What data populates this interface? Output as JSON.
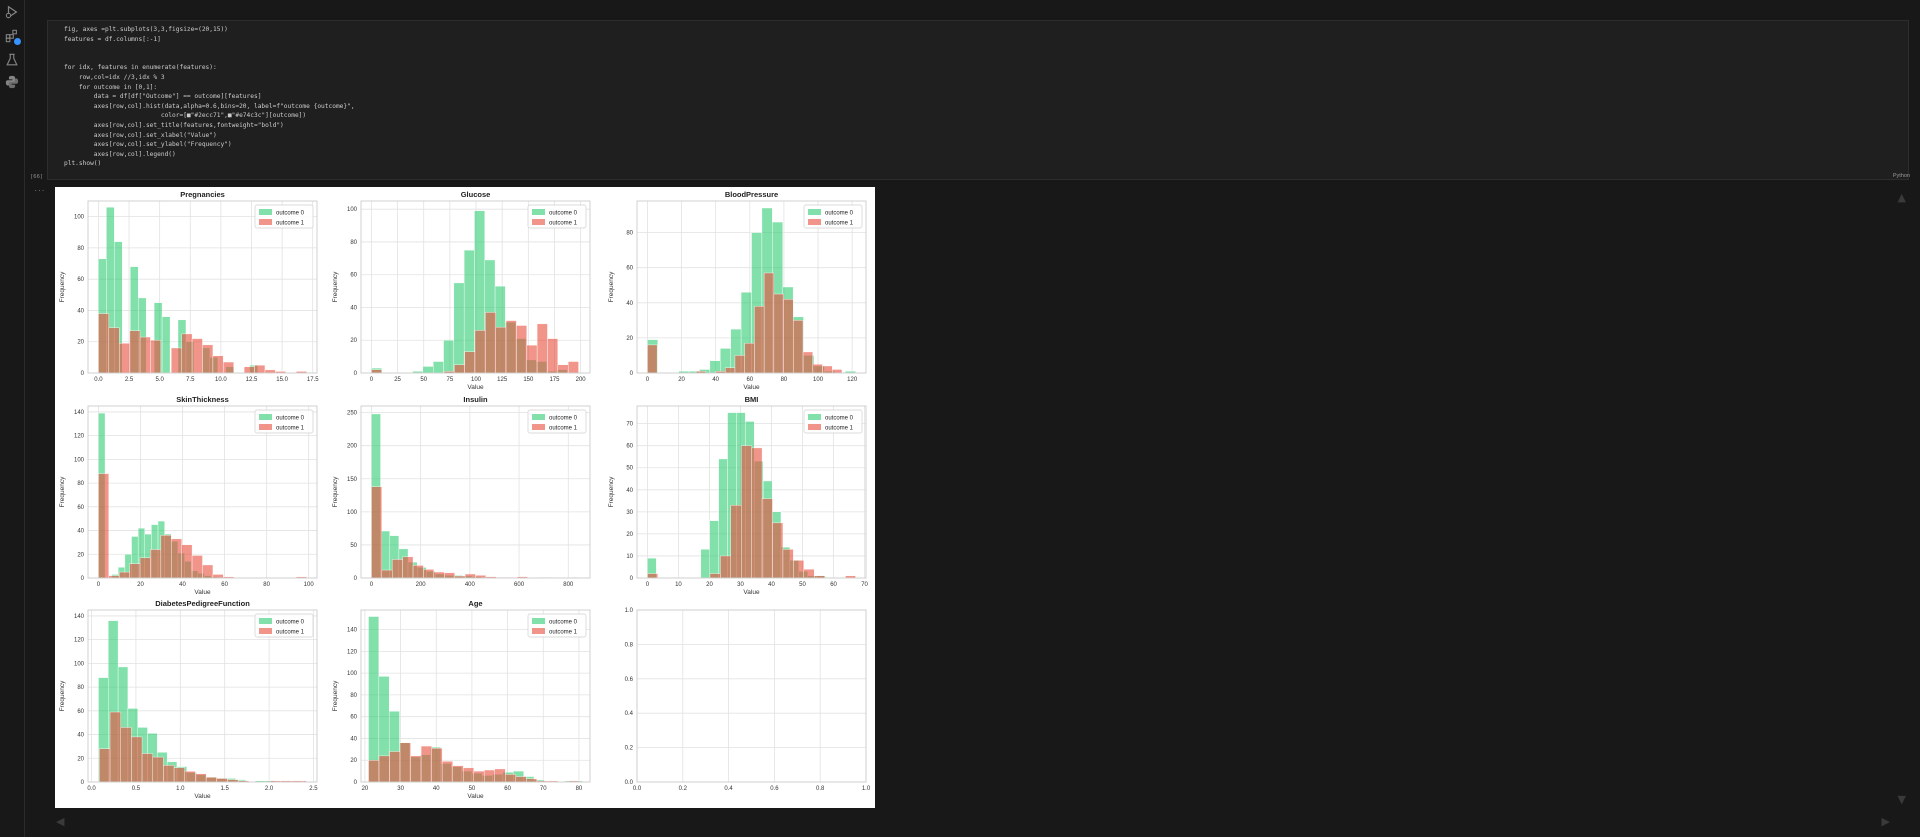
{
  "code_lines": [
    "fig, axes =plt.subplots(3,3,figsize=(20,15))",
    "features = df.columns[:-1]",
    "",
    "",
    "for idx, features in enumerate(features):",
    "    row,col=idx //3,idx % 3",
    "    for outcome in [0,1]:",
    "        data = df[df[\"Outcome\"] == outcome][features]",
    "        axes[row,col].hist(data,alpha=0.6,bins=20, label=f\"outcome {outcome}\",",
    "                          color=[■\"#2ecc71\",■\"#e74c3c\"][outcome])",
    "        axes[row,col].set_title(features,fontweight=\"bold\")",
    "        axes[row,col].set_xlabel(\"Value\")",
    "        axes[row,col].set_ylabel(\"Frequency\")",
    "        axes[row,col].legend()",
    "plt.show()"
  ],
  "exec_count": "[66]",
  "exec_ellipsis": "...",
  "language": "Python",
  "colors": {
    "outcome0": "#2ecc71",
    "outcome1": "#e74c3c"
  },
  "icons": [
    "run-debug-icon",
    "extensions-icon",
    "testing-icon",
    "python-icon"
  ],
  "chart_data": [
    {
      "type": "bar",
      "title": "Pregnancies",
      "xlabel": "",
      "ylabel": "Frequency",
      "xlim": [
        -0.85,
        17.85
      ],
      "ylim": [
        0,
        110
      ],
      "xticks": [
        0,
        2.5,
        5,
        7.5,
        10,
        12.5,
        15,
        17.5
      ],
      "xticklabels": [
        "0.0",
        "2.5",
        "5.0",
        "7.5",
        "10.0",
        "12.5",
        "15.0",
        "17.5"
      ],
      "yticks": [
        0,
        20,
        40,
        60,
        80,
        100
      ],
      "legend": "top-right",
      "series": [
        {
          "name": "outcome 0",
          "bins": [
            0,
            0.65,
            1.3,
            1.95,
            2.6,
            3.25,
            3.9,
            4.55,
            5.2,
            5.85,
            6.5,
            7.15,
            7.8,
            8.45,
            9.1,
            9.75,
            10.4,
            11.05,
            11.7,
            12.35,
            13
          ],
          "values": [
            73,
            106,
            84,
            0,
            68,
            48,
            0,
            45,
            36,
            0,
            34,
            20,
            0,
            16,
            10,
            0,
            4,
            0,
            0,
            5
          ]
        },
        {
          "name": "outcome 1",
          "bins": [
            0,
            0.85,
            1.7,
            2.55,
            3.4,
            4.25,
            5.1,
            5.95,
            6.8,
            7.65,
            8.5,
            9.35,
            10.2,
            11.05,
            11.9,
            12.75,
            13.6,
            14.45,
            15.3,
            16.15,
            17
          ],
          "values": [
            38,
            29,
            19,
            27,
            23,
            21,
            0,
            16,
            25,
            22,
            18,
            11,
            7,
            0,
            4,
            5,
            2,
            1,
            0,
            1
          ]
        }
      ]
    },
    {
      "type": "bar",
      "title": "Glucose",
      "xlabel": "Value",
      "ylabel": "Frequency",
      "xlim": [
        -9.95,
        208.95
      ],
      "ylim": [
        0,
        105
      ],
      "xticks": [
        0,
        25,
        50,
        75,
        100,
        125,
        150,
        175,
        200
      ],
      "xticklabels": [
        "0",
        "25",
        "50",
        "75",
        "100",
        "125",
        "150",
        "175",
        "200"
      ],
      "yticks": [
        0,
        20,
        40,
        60,
        80,
        100
      ],
      "legend": "top-right",
      "series": [
        {
          "name": "outcome 0",
          "bins": [
            0,
            9.85,
            19.7,
            29.55,
            39.4,
            49.25,
            59.1,
            68.95,
            78.8,
            88.65,
            98.5,
            108.35,
            118.2,
            128.05,
            137.9,
            147.75,
            157.6,
            167.45,
            177.3,
            187.15,
            197
          ],
          "values": [
            3,
            0,
            0,
            0,
            1,
            4,
            7,
            20,
            55,
            75,
            99,
            69,
            53,
            31,
            21,
            8,
            7,
            1,
            2,
            0
          ]
        },
        {
          "name": "outcome 1",
          "bins": [
            0,
            9.9,
            19.8,
            29.7,
            39.6,
            49.5,
            59.4,
            69.3,
            79.2,
            89.1,
            99,
            108.9,
            118.8,
            128.7,
            138.6,
            148.5,
            158.4,
            168.3,
            178.2,
            188.1,
            198
          ],
          "values": [
            2,
            0,
            0,
            0,
            0,
            0,
            0,
            1,
            5,
            13,
            26,
            37,
            28,
            32,
            29,
            17,
            30,
            21,
            5,
            7
          ]
        }
      ]
    },
    {
      "type": "bar",
      "title": "BloodPressure",
      "xlabel": "Value",
      "ylabel": "Frequency",
      "xlim": [
        -6.1,
        128.1
      ],
      "ylim": [
        0,
        98
      ],
      "xticks": [
        0,
        20,
        40,
        60,
        80,
        100,
        120
      ],
      "xticklabels": [
        "0",
        "20",
        "40",
        "60",
        "80",
        "100",
        "120"
      ],
      "yticks": [
        0,
        20,
        40,
        60,
        80
      ],
      "legend": "top-right",
      "series": [
        {
          "name": "outcome 0",
          "bins": [
            0,
            6.1,
            12.2,
            18.3,
            24.4,
            30.5,
            36.6,
            42.7,
            48.8,
            54.9,
            61,
            67.1,
            73.2,
            79.3,
            85.4,
            91.5,
            97.6,
            103.7,
            109.8,
            115.9,
            122
          ],
          "values": [
            19,
            0,
            0,
            1,
            1,
            2,
            7,
            14,
            25,
            46,
            80,
            94,
            86,
            49,
            32,
            10,
            4,
            1,
            0,
            1
          ]
        },
        {
          "name": "outcome 1",
          "bins": [
            0,
            5.7,
            11.4,
            17.1,
            22.8,
            28.5,
            34.2,
            39.9,
            45.6,
            51.3,
            57,
            62.7,
            68.4,
            74.1,
            79.8,
            85.5,
            91.2,
            96.9,
            102.6,
            108.3,
            114
          ],
          "values": [
            16,
            0,
            0,
            0,
            0,
            1,
            0,
            1,
            3,
            10,
            17,
            38,
            57,
            45,
            42,
            30,
            12,
            5,
            4,
            2
          ]
        }
      ]
    },
    {
      "type": "bar",
      "title": "SkinThickness",
      "xlabel": "Value",
      "ylabel": "Frequency",
      "xlim": [
        -4.95,
        103.95
      ],
      "ylim": [
        0,
        145
      ],
      "xticks": [
        0,
        20,
        40,
        60,
        80,
        100
      ],
      "xticklabels": [
        "0",
        "20",
        "40",
        "60",
        "80",
        "100"
      ],
      "yticks": [
        0,
        20,
        40,
        60,
        80,
        100,
        120,
        140
      ],
      "legend": "top-right",
      "series": [
        {
          "name": "outcome 0",
          "bins": [
            0,
            3.15,
            6.3,
            9.45,
            12.6,
            15.75,
            18.9,
            22.05,
            25.2,
            28.35,
            31.5,
            34.65,
            37.8,
            40.95,
            44.1,
            47.25,
            50.4,
            53.55,
            56.7,
            59.85,
            63
          ],
          "values": [
            139,
            0,
            3,
            9,
            20,
            35,
            42,
            37,
            45,
            48,
            37,
            31,
            21,
            14,
            6,
            4,
            2,
            1,
            0,
            0
          ]
        },
        {
          "name": "outcome 1",
          "bins": [
            0,
            4.95,
            9.9,
            14.85,
            19.8,
            24.75,
            29.7,
            34.65,
            39.6,
            44.55,
            49.5,
            54.45,
            59.4,
            64.35,
            69.3,
            74.25,
            79.2,
            84.15,
            89.1,
            94.05,
            99
          ],
          "values": [
            88,
            2,
            5,
            12,
            17,
            24,
            36,
            33,
            28,
            19,
            11,
            3,
            1,
            0,
            0,
            0,
            0,
            0,
            0,
            1
          ]
        }
      ]
    },
    {
      "type": "bar",
      "title": "Insulin",
      "xlabel": "",
      "ylabel": "Frequency",
      "xlim": [
        -42.3,
        888.3
      ],
      "ylim": [
        0,
        260
      ],
      "xticks": [
        0,
        200,
        400,
        600,
        800
      ],
      "xticklabels": [
        "0",
        "200",
        "400",
        "600",
        "800"
      ],
      "yticks": [
        0,
        50,
        100,
        150,
        200,
        250
      ],
      "legend": "top-right",
      "series": [
        {
          "name": "outcome 0",
          "bins": [
            0,
            37.2,
            74.4,
            111.6,
            148.8,
            186,
            223.2,
            260.4,
            297.6,
            334.8,
            372,
            409.2,
            446.4,
            483.6,
            520.8,
            558,
            595.2,
            632.4,
            669.6,
            706.8,
            744
          ],
          "values": [
            248,
            71,
            64,
            44,
            24,
            16,
            10,
            6,
            4,
            4,
            3,
            2,
            1,
            0,
            1,
            0,
            0,
            0,
            0,
            1
          ]
        },
        {
          "name": "outcome 1",
          "bins": [
            0,
            42.3,
            84.6,
            126.9,
            169.2,
            211.5,
            253.8,
            296.1,
            338.4,
            380.7,
            423,
            465.3,
            507.6,
            549.9,
            592.2,
            634.5,
            676.8,
            719.1,
            761.4,
            803.7,
            846
          ],
          "values": [
            138,
            12,
            28,
            32,
            19,
            13,
            9,
            8,
            3,
            6,
            4,
            2,
            1,
            1,
            2,
            0,
            1,
            0,
            0,
            1
          ]
        }
      ]
    },
    {
      "type": "bar",
      "title": "BMI",
      "xlabel": "Value",
      "ylabel": "Frequency",
      "xlim": [
        -3.36,
        70.46
      ],
      "ylim": [
        0,
        78
      ],
      "xticks": [
        0,
        10,
        20,
        30,
        40,
        50,
        60,
        70
      ],
      "xticklabels": [
        "0",
        "10",
        "20",
        "30",
        "40",
        "50",
        "60",
        "70"
      ],
      "yticks": [
        0,
        10,
        20,
        30,
        40,
        50,
        60,
        70
      ],
      "legend": "top-right",
      "series": [
        {
          "name": "outcome 0",
          "bins": [
            0,
            2.87,
            5.74,
            8.61,
            11.48,
            14.35,
            17.22,
            20.09,
            22.96,
            25.83,
            28.7,
            31.57,
            34.44,
            37.31,
            40.18,
            43.05,
            45.92,
            48.79,
            51.66,
            54.53,
            57.4
          ],
          "values": [
            9,
            0,
            0,
            0,
            0,
            0,
            13,
            26,
            54,
            75,
            75,
            71,
            53,
            44,
            30,
            14,
            8,
            3,
            1,
            1
          ]
        },
        {
          "name": "outcome 1",
          "bins": [
            0,
            3.36,
            6.72,
            10.08,
            13.44,
            16.8,
            20.16,
            23.52,
            26.88,
            30.24,
            33.6,
            36.96,
            40.32,
            43.68,
            47.04,
            50.4,
            53.76,
            57.12,
            60.48,
            63.84,
            67.1
          ],
          "values": [
            2,
            0,
            0,
            0,
            0,
            0,
            2,
            10,
            33,
            60,
            59,
            36,
            25,
            13,
            8,
            4,
            1,
            0,
            0,
            1
          ]
        }
      ]
    },
    {
      "type": "bar",
      "title": "DiabetesPedigreeFunction",
      "xlabel": "Value",
      "ylabel": "Frequency",
      "xlim": [
        -0.04,
        2.54
      ],
      "ylim": [
        0,
        145
      ],
      "xticks": [
        0,
        0.5,
        1,
        1.5,
        2,
        2.5
      ],
      "xticklabels": [
        "0.0",
        "0.5",
        "1.0",
        "1.5",
        "2.0",
        "2.5"
      ],
      "yticks": [
        0,
        20,
        40,
        60,
        80,
        100,
        120,
        140
      ],
      "legend": "top-right",
      "series": [
        {
          "name": "outcome 0",
          "bins": [
            0.078,
            0.1885,
            0.299,
            0.4095,
            0.52,
            0.6305,
            0.741,
            0.8515,
            0.962,
            1.0725,
            1.183,
            1.2935,
            1.404,
            1.5145,
            1.625,
            1.7355,
            1.846,
            1.9565,
            2.067,
            2.1775,
            2.288
          ],
          "values": [
            88,
            136,
            97,
            62,
            46,
            41,
            25,
            17,
            13,
            8,
            6,
            4,
            3,
            3,
            2,
            0,
            1,
            1,
            0,
            0
          ]
        },
        {
          "name": "outcome 1",
          "bins": [
            0.088,
            0.2083,
            0.3285,
            0.4488,
            0.569,
            0.6893,
            0.8095,
            0.9298,
            1.05,
            1.1703,
            1.2905,
            1.4108,
            1.531,
            1.6513,
            1.7715,
            1.8918,
            2.012,
            2.1323,
            2.2525,
            2.3728,
            2.42
          ],
          "values": [
            28,
            59,
            46,
            38,
            24,
            21,
            14,
            12,
            9,
            7,
            4,
            3,
            2,
            1,
            0,
            0,
            1,
            1,
            1,
            1
          ]
        }
      ]
    },
    {
      "type": "bar",
      "title": "Age",
      "xlabel": "Value",
      "ylabel": "Frequency",
      "xlim": [
        18.9,
        83.1
      ],
      "ylim": [
        0,
        158
      ],
      "xticks": [
        20,
        30,
        40,
        50,
        60,
        70,
        80
      ],
      "xticklabels": [
        "20",
        "30",
        "40",
        "50",
        "60",
        "70",
        "80"
      ],
      "yticks": [
        0,
        20,
        40,
        60,
        80,
        100,
        120,
        140
      ],
      "legend": "top-right",
      "series": [
        {
          "name": "outcome 0",
          "bins": [
            21,
            23.9,
            26.8,
            29.7,
            32.6,
            35.5,
            38.4,
            41.3,
            44.2,
            47.1,
            50,
            52.9,
            55.8,
            58.7,
            61.6,
            64.5,
            67.4,
            70.3,
            73.2,
            76.1,
            81
          ],
          "values": [
            152,
            97,
            65,
            36,
            23,
            25,
            32,
            17,
            14,
            10,
            8,
            6,
            7,
            9,
            10,
            5,
            2,
            0,
            0,
            1
          ]
        },
        {
          "name": "outcome 1",
          "bins": [
            21,
            23.95,
            26.9,
            29.85,
            32.8,
            35.75,
            38.7,
            41.65,
            44.6,
            47.55,
            50.5,
            53.45,
            56.4,
            59.35,
            62.3,
            65.25,
            68.2,
            71.15,
            74.1,
            77.05,
            80
          ],
          "values": [
            20,
            24,
            28,
            36,
            24,
            33,
            31,
            19,
            15,
            13,
            10,
            11,
            12,
            7,
            5,
            3,
            1,
            1,
            0,
            1
          ]
        }
      ]
    },
    {
      "type": "bar",
      "title": "",
      "xlabel": "",
      "ylabel": "",
      "xlim": [
        0,
        1
      ],
      "ylim": [
        0,
        1
      ],
      "xticks": [
        0,
        0.2,
        0.4,
        0.6,
        0.8,
        1
      ],
      "xticklabels": [
        "0.0",
        "0.2",
        "0.4",
        "0.6",
        "0.8",
        "1.0"
      ],
      "yticks": [
        0,
        0.2,
        0.4,
        0.6,
        0.8,
        1
      ],
      "yticklabels": [
        "0.0",
        "0.2",
        "0.4",
        "0.6",
        "0.8",
        "1.0"
      ],
      "legend": "none",
      "series": []
    }
  ]
}
